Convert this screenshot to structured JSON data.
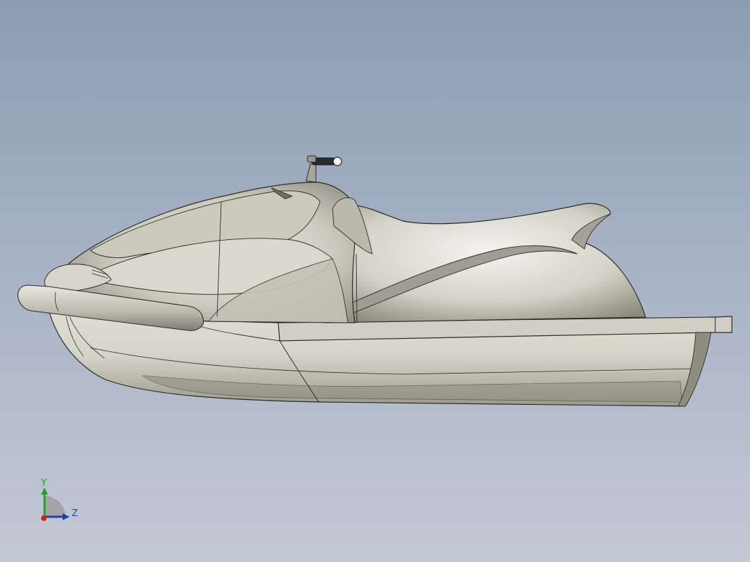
{
  "viewport": {
    "background_top": "#8b9cb3",
    "background_bottom": "#c3c8d4"
  },
  "model": {
    "body_color": "#d9d9cf",
    "shadow_color": "#8e8e80",
    "edge_color": "#2a2a26"
  },
  "triad": {
    "y_label": "Y",
    "z_label": "Z",
    "y_color": "#1fa21f",
    "z_color": "#1f3fb0",
    "x_color": "#d02020"
  }
}
